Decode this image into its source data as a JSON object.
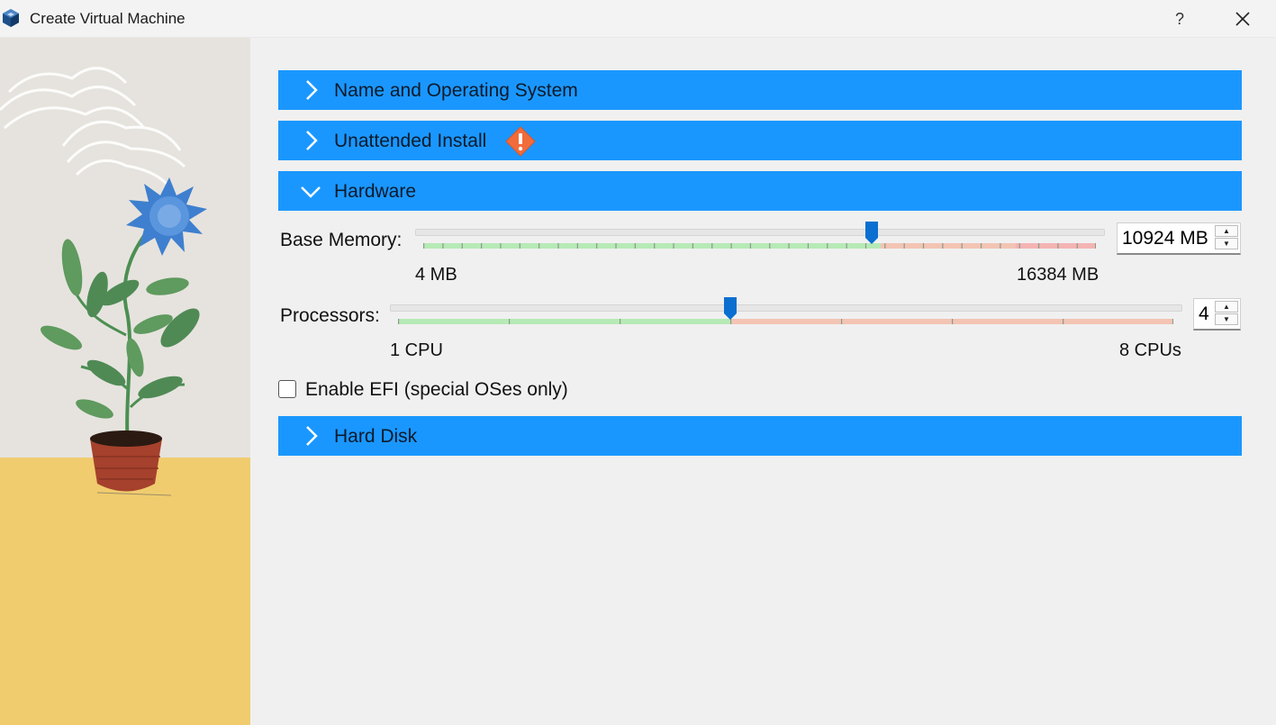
{
  "window": {
    "title": "Create Virtual Machine",
    "help_label": "?"
  },
  "sections": {
    "name_os": {
      "label": "Name and Operating System",
      "expanded": false
    },
    "unattended": {
      "label": "Unattended Install",
      "expanded": false,
      "warning_icon": "warning-icon"
    },
    "hardware": {
      "label": "Hardware",
      "expanded": true
    },
    "hard_disk": {
      "label": "Hard Disk",
      "expanded": false
    }
  },
  "hardware": {
    "memory": {
      "label": "Base Memory:",
      "value": 10924,
      "unit": "MB",
      "display": "10924 MB",
      "min": 4,
      "max": 16384,
      "min_label": "4 MB",
      "max_label": "16384 MB"
    },
    "processors": {
      "label": "Processors:",
      "value": 4,
      "display": "4",
      "min": 1,
      "max": 8,
      "min_label": "1 CPU",
      "max_label": "8 CPUs"
    },
    "efi": {
      "label": "Enable EFI (special OSes only)",
      "checked": false
    }
  },
  "colors": {
    "section_bar": "#1a97ff",
    "slider_thumb": "#0a6fd0",
    "scale_ok": "#b6eab6",
    "scale_warn": "#f3c4b4",
    "scale_danger": "#f4b4b4"
  }
}
